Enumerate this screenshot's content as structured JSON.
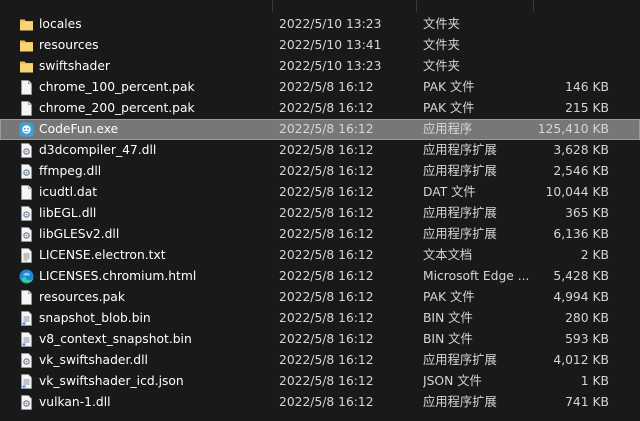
{
  "files": [
    {
      "icon": "folder-icon",
      "name": "locales",
      "date": "2022/5/10 13:23",
      "type": "文件夹",
      "size": ""
    },
    {
      "icon": "folder-icon",
      "name": "resources",
      "date": "2022/5/10 13:41",
      "type": "文件夹",
      "size": ""
    },
    {
      "icon": "folder-icon",
      "name": "swiftshader",
      "date": "2022/5/10 13:23",
      "type": "文件夹",
      "size": ""
    },
    {
      "icon": "file-icon",
      "name": "chrome_100_percent.pak",
      "date": "2022/5/8 16:12",
      "type": "PAK 文件",
      "size": "146 KB"
    },
    {
      "icon": "file-icon",
      "name": "chrome_200_percent.pak",
      "date": "2022/5/8 16:12",
      "type": "PAK 文件",
      "size": "215 KB"
    },
    {
      "icon": "app-icon",
      "name": "CodeFun.exe",
      "date": "2022/5/8 16:12",
      "type": "应用程序",
      "size": "125,410 KB",
      "selected": true
    },
    {
      "icon": "dll-icon",
      "name": "d3dcompiler_47.dll",
      "date": "2022/5/8 16:12",
      "type": "应用程序扩展",
      "size": "3,628 KB"
    },
    {
      "icon": "dll-icon",
      "name": "ffmpeg.dll",
      "date": "2022/5/8 16:12",
      "type": "应用程序扩展",
      "size": "2,546 KB"
    },
    {
      "icon": "file-icon",
      "name": "icudtl.dat",
      "date": "2022/5/8 16:12",
      "type": "DAT 文件",
      "size": "10,044 KB"
    },
    {
      "icon": "dll-icon",
      "name": "libEGL.dll",
      "date": "2022/5/8 16:12",
      "type": "应用程序扩展",
      "size": "365 KB"
    },
    {
      "icon": "dll-icon",
      "name": "libGLESv2.dll",
      "date": "2022/5/8 16:12",
      "type": "应用程序扩展",
      "size": "6,136 KB"
    },
    {
      "icon": "text-file-icon",
      "name": "LICENSE.electron.txt",
      "date": "2022/5/8 16:12",
      "type": "文本文档",
      "size": "2 KB"
    },
    {
      "icon": "edge-icon",
      "name": "LICENSES.chromium.html",
      "date": "2022/5/8 16:12",
      "type": "Microsoft Edge ...",
      "size": "5,428 KB"
    },
    {
      "icon": "file-icon",
      "name": "resources.pak",
      "date": "2022/5/8 16:12",
      "type": "PAK 文件",
      "size": "4,994 KB"
    },
    {
      "icon": "bin-icon",
      "name": "snapshot_blob.bin",
      "date": "2022/5/8 16:12",
      "type": "BIN 文件",
      "size": "280 KB"
    },
    {
      "icon": "bin-icon",
      "name": "v8_context_snapshot.bin",
      "date": "2022/5/8 16:12",
      "type": "BIN 文件",
      "size": "593 KB"
    },
    {
      "icon": "dll-icon",
      "name": "vk_swiftshader.dll",
      "date": "2022/5/8 16:12",
      "type": "应用程序扩展",
      "size": "4,012 KB"
    },
    {
      "icon": "bin-icon",
      "name": "vk_swiftshader_icd.json",
      "date": "2022/5/8 16:12",
      "type": "JSON 文件",
      "size": "1 KB"
    },
    {
      "icon": "dll-icon",
      "name": "vulkan-1.dll",
      "date": "2022/5/8 16:12",
      "type": "应用程序扩展",
      "size": "741 KB"
    }
  ]
}
